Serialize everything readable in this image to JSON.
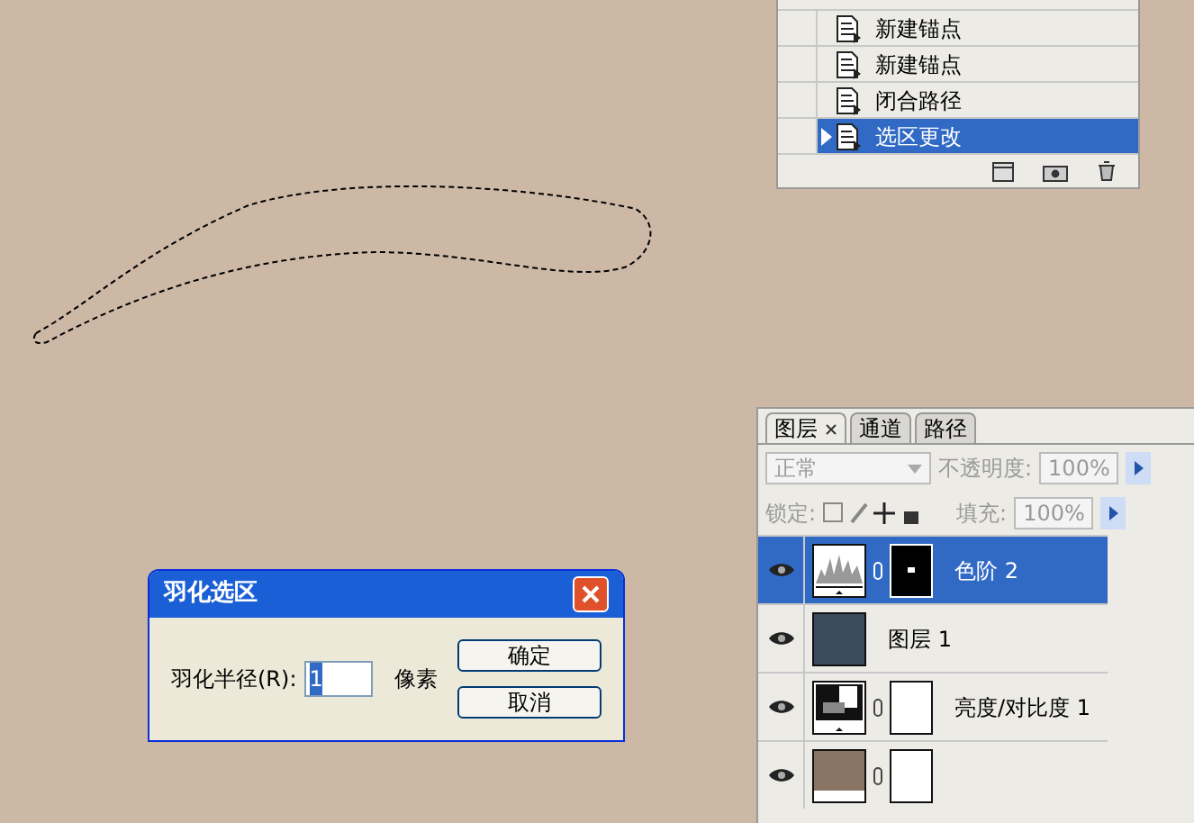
{
  "history": {
    "items": [
      {
        "label": "新建锚点",
        "selected": false
      },
      {
        "label": "新建锚点",
        "selected": false
      },
      {
        "label": "闭合路径",
        "selected": false
      },
      {
        "label": "选区更改",
        "selected": true
      }
    ]
  },
  "layers_panel": {
    "tabs": [
      {
        "label": "图层",
        "selected": true
      },
      {
        "label": "通道",
        "selected": false
      },
      {
        "label": "路径",
        "selected": false
      }
    ],
    "blend_mode": "正常",
    "opacity_label": "不透明度:",
    "opacity": "100%",
    "lock_label": "锁定:",
    "fill_label": "填充:",
    "fill": "100%",
    "layers": [
      {
        "name": "色阶 2",
        "kind": "levels",
        "selected": true,
        "visible": true
      },
      {
        "name": "图层 1",
        "kind": "image",
        "selected": false,
        "visible": true
      },
      {
        "name": "亮度/对比度 1",
        "kind": "contrast",
        "selected": false,
        "visible": true
      },
      {
        "kind": "color",
        "selected": false,
        "visible": true
      }
    ]
  },
  "dialog": {
    "title": "羽化选区",
    "label": "羽化半径(R):",
    "value": "1",
    "unit": "像素",
    "buttons": [
      "确定",
      "取消"
    ]
  }
}
